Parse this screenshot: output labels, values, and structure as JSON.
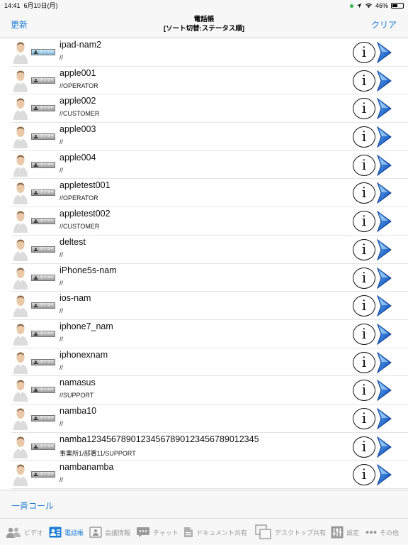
{
  "status": {
    "time": "14:41",
    "date": "6月10日(月)",
    "battery": "46%"
  },
  "nav": {
    "left_label": "更新",
    "title_line1": "電話帳",
    "title_line2": "[ソート切替:ステータス順]",
    "right_label": "クリア"
  },
  "contacts": [
    {
      "name": "ipad-nam2",
      "sub": "//",
      "status": "オンライン",
      "online": true
    },
    {
      "name": "apple001",
      "sub": "//OPERATOR",
      "status": "オフライン",
      "online": false
    },
    {
      "name": "apple002",
      "sub": "//CUSTOMER",
      "status": "オフライン",
      "online": false
    },
    {
      "name": "apple003",
      "sub": "//",
      "status": "オフライン",
      "online": false
    },
    {
      "name": "apple004",
      "sub": "//",
      "status": "オフライン",
      "online": false
    },
    {
      "name": "appletest001",
      "sub": "//OPERATOR",
      "status": "オフライン",
      "online": false
    },
    {
      "name": "appletest002",
      "sub": "//CUSTOMER",
      "status": "オフライン",
      "online": false
    },
    {
      "name": "deltest",
      "sub": "//",
      "status": "オフライン",
      "online": false
    },
    {
      "name": "iPhone5s-nam",
      "sub": "//",
      "status": "オフライン",
      "online": false
    },
    {
      "name": "ios-nam",
      "sub": "//",
      "status": "オフライン",
      "online": false
    },
    {
      "name": "iphone7_nam",
      "sub": "//",
      "status": "オフライン",
      "online": false
    },
    {
      "name": "iphonexnam",
      "sub": "//",
      "status": "オフライン",
      "online": false
    },
    {
      "name": "namasus",
      "sub": "//SUPPORT",
      "status": "オフライン",
      "online": false
    },
    {
      "name": "namba10",
      "sub": "//",
      "status": "オフライン",
      "online": false
    },
    {
      "name": "namba12345678901234567890123456789012345",
      "sub": "事業所1/部署11/SUPPORT",
      "status": "オフライン",
      "online": false
    },
    {
      "name": "nambanamba",
      "sub": "//",
      "status": "オフライン",
      "online": false
    }
  ],
  "info_glyph": "i",
  "bulk_call": "一斉コール",
  "tabs": [
    {
      "label": "ビデオ",
      "icon": "video-people-icon",
      "active": false
    },
    {
      "label": "電話帳",
      "icon": "contacts-icon",
      "active": true
    },
    {
      "label": "会議情報",
      "icon": "meeting-info-icon",
      "active": false
    },
    {
      "label": "チャット",
      "icon": "chat-icon",
      "active": false
    },
    {
      "label": "ドキュメント共有",
      "icon": "document-icon",
      "active": false
    },
    {
      "label": "デスクトップ共有",
      "icon": "desktop-share-icon",
      "active": false
    },
    {
      "label": "設定",
      "icon": "settings-sliders-icon",
      "active": false
    },
    {
      "label": "その他",
      "icon": "more-icon",
      "active": false
    }
  ],
  "colors": {
    "accent": "#1a7bd6",
    "inactive": "#9a9a9a",
    "bar": "#f7f7f7"
  }
}
